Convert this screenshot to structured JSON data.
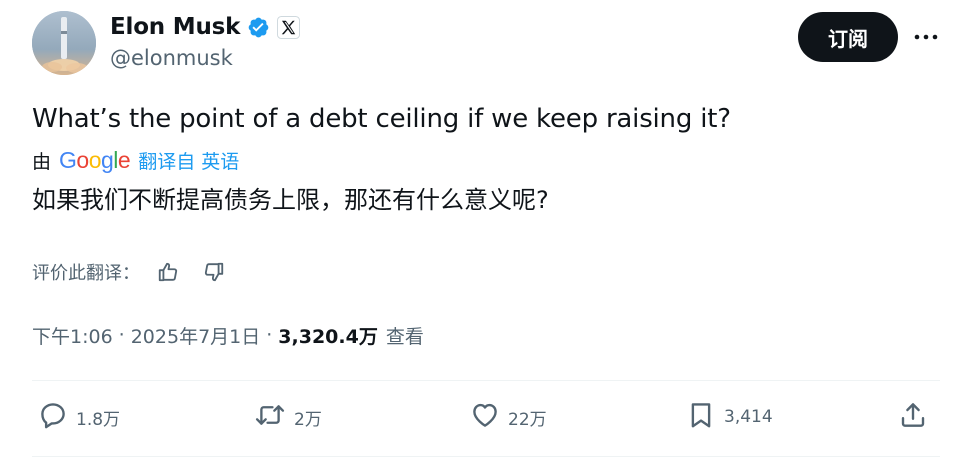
{
  "author": {
    "display_name": "Elon Musk",
    "handle": "@elonmusk"
  },
  "header": {
    "subscribe_label": "订阅"
  },
  "tweet": {
    "text": "What’s the point of a debt ceiling if we keep raising it?",
    "translated_text": "如果我们不断提高债务上限，那还有什么意义呢?"
  },
  "translation": {
    "by_label": "由",
    "provider_name": "Google",
    "from_label": "翻译自 英语",
    "rate_label": "评价此翻译："
  },
  "meta": {
    "time": "下午1:06",
    "separator": "·",
    "date": "2025年7月1日",
    "views_count": "3,320.4万",
    "views_label": "查看"
  },
  "actions": {
    "replies": "1.8万",
    "retweets": "2万",
    "likes": "22万",
    "bookmarks": "3,414"
  },
  "colors": {
    "accent": "#1d9bf0",
    "text_primary": "#0f1419",
    "text_secondary": "#536471",
    "divider": "#eff3f4",
    "google_blue": "#4285F4",
    "google_red": "#EA4335",
    "google_yellow": "#FBBC05",
    "google_green": "#34A853"
  },
  "icons": [
    "verified-badge-icon",
    "x-logo-icon",
    "more-icon",
    "thumbs-up-icon",
    "thumbs-down-icon",
    "reply-icon",
    "retweet-icon",
    "like-icon",
    "bookmark-icon",
    "share-icon"
  ]
}
